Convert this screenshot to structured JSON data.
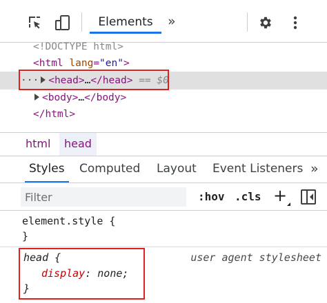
{
  "toolbar": {
    "icons": [
      "inspect-cursor-icon",
      "device-toggle-icon",
      "gear-icon",
      "kebab-menu-icon"
    ],
    "active_tab": "Elements",
    "more_tabs": "»"
  },
  "dom": {
    "doctype": "<!DOCTYPE html>",
    "html_open_tag": "html",
    "html_attr_name": "lang",
    "html_attr_value": "\"en\"",
    "head_ellipsis": "…",
    "head_tag": "head",
    "head_selected_marker": "== $0",
    "row_dots": "···",
    "body_tag": "body",
    "body_ellipsis": "…",
    "html_close_tag": "html",
    "lt": "<",
    "gt": ">",
    "lt_slash": "</",
    "eq": "="
  },
  "breadcrumb": {
    "items": [
      "html",
      "head"
    ]
  },
  "subtabs": {
    "items": [
      "Styles",
      "Computed",
      "Layout",
      "Event Listeners"
    ],
    "more": "»"
  },
  "filterbar": {
    "placeholder": "Filter",
    "hov": ":hov",
    "cls": ".cls",
    "plus": "+"
  },
  "rules": {
    "element_style_selector": "element.style {",
    "element_style_close": "}",
    "head_selector": "head",
    "open_brace": " {",
    "property": "display",
    "colon": ": ",
    "value": "none",
    "semicolon": ";",
    "close_brace": "}",
    "source": "user agent stylesheet"
  }
}
